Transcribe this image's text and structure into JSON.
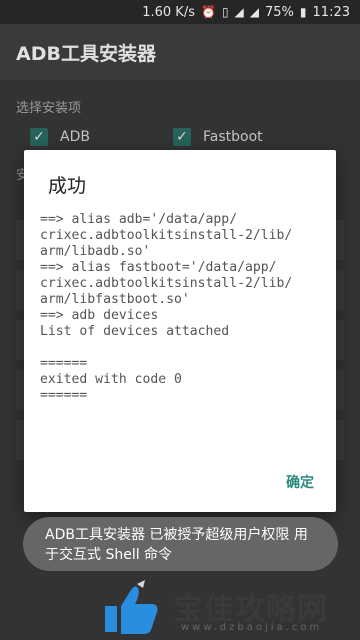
{
  "status_bar": {
    "speed": "1.60 K/s",
    "battery": "75%",
    "time": "11:23",
    "icons": [
      "alarm-icon",
      "vibrate-icon",
      "wifi-icon",
      "signal-icon",
      "battery-icon"
    ]
  },
  "app": {
    "title": "ADB工具安装器"
  },
  "background": {
    "section_label": "选择安装项",
    "option_adb": "ADB",
    "option_fastboot": "Fastboot",
    "section_label_2": "安"
  },
  "dialog": {
    "title": "成功",
    "log": "==> alias adb='/data/app/\ncrixec.adbtoolkitsinstall-2/lib/\narm/libadb.so'\n==> alias fastboot='/data/app/\ncrixec.adbtoolkitsinstall-2/lib/\narm/libfastboot.so'\n==> adb devices\nList of devices attached\n\n======\nexited with code 0\n======",
    "ok_label": "确定"
  },
  "toast": {
    "message": "ADB工具安装器 已被授予超级用户权限 用于交互式 Shell 命令"
  },
  "watermark": {
    "name": "宝佳攻略网",
    "url": "www.dzbaojia.com"
  },
  "colors": {
    "accent": "#2b8a7e",
    "checkbox": "#26635a",
    "toast_bg": "#666666",
    "logo_blue": "#2a8ee0"
  }
}
